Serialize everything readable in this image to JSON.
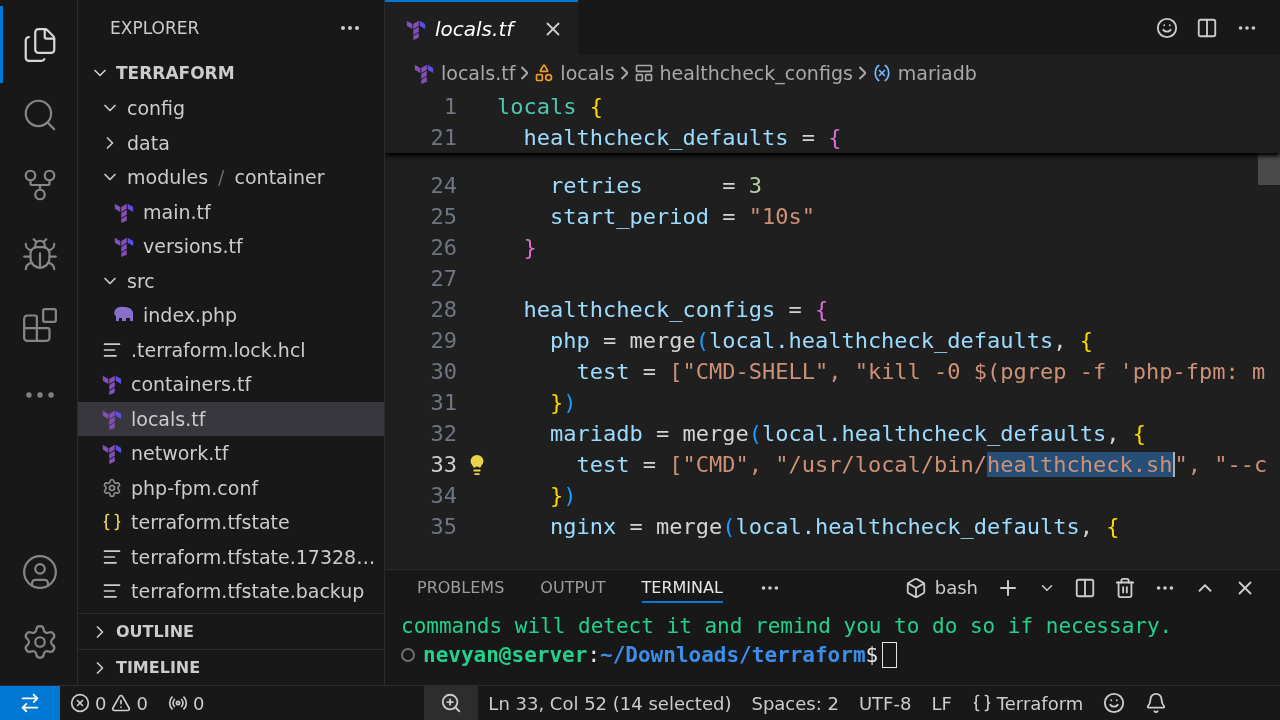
{
  "activity_bar": {
    "top": [
      {
        "kind": "explorer",
        "selected": true
      },
      {
        "kind": "search",
        "selected": false
      },
      {
        "kind": "source_control",
        "selected": false
      },
      {
        "kind": "run_debug",
        "selected": false
      },
      {
        "kind": "extensions",
        "selected": false
      },
      {
        "kind": "more",
        "selected": false
      }
    ],
    "bottom": [
      {
        "kind": "accounts"
      },
      {
        "kind": "manage"
      }
    ]
  },
  "sidebar": {
    "title": "EXPLORER",
    "folder": {
      "label": "TERRAFORM",
      "expanded": true,
      "items": [
        {
          "kind": "folder",
          "label": "config",
          "expanded": true,
          "selected": false
        },
        {
          "kind": "folder",
          "label": "data",
          "expanded": false,
          "selected": false
        },
        {
          "kind": "folder",
          "label": "modules",
          "label_2": "container",
          "separator": "/",
          "expanded": true,
          "selected": false,
          "children": [
            {
              "kind": "terraform",
              "label": "main.tf",
              "selected": false
            },
            {
              "kind": "terraform",
              "label": "versions.tf",
              "selected": false
            }
          ]
        },
        {
          "kind": "folder",
          "label": "src",
          "expanded": true,
          "selected": false,
          "children": [
            {
              "kind": "php",
              "label": "index.php",
              "selected": false
            }
          ]
        },
        {
          "kind": "lines",
          "label": ".terraform.lock.hcl",
          "selected": false
        },
        {
          "kind": "terraform",
          "label": "containers.tf",
          "selected": false
        },
        {
          "kind": "terraform",
          "label": "locals.tf",
          "selected": true
        },
        {
          "kind": "terraform",
          "label": "network.tf",
          "selected": false
        },
        {
          "kind": "gear",
          "label": "php-fpm.conf",
          "selected": false
        },
        {
          "kind": "braces",
          "label": "terraform.tfstate",
          "selected": false
        },
        {
          "kind": "lines",
          "label": "terraform.tfstate.17328…",
          "selected": false
        },
        {
          "kind": "lines",
          "label": "terraform.tfstate.backup",
          "selected": false
        }
      ]
    },
    "sections": [
      {
        "label": "OUTLINE",
        "expanded": false
      },
      {
        "label": "TIMELINE",
        "expanded": false
      }
    ]
  },
  "editor": {
    "tab": {
      "label": "locals.tf",
      "preview": true,
      "selected": true
    },
    "actions": [
      {
        "kind": "smile"
      },
      {
        "kind": "split"
      },
      {
        "kind": "more"
      }
    ],
    "breadcrumb": [
      {
        "kind": "file",
        "label": "locals.tf"
      },
      {
        "kind": "block",
        "label": "locals"
      },
      {
        "kind": "object",
        "label": "healthcheck_configs"
      },
      {
        "kind": "variable",
        "label": "mariadb"
      }
    ],
    "sticky_lines": [
      {
        "number": "1",
        "tokens": [
          {
            "t": "locals ",
            "kind": "kw"
          },
          {
            "t": "{",
            "kind": "b1"
          }
        ]
      },
      {
        "number": "21",
        "tokens": [
          {
            "t": "  healthcheck_defaults",
            "kind": "id"
          },
          {
            "t": " = ",
            "kind": "plain"
          },
          {
            "t": "{",
            "kind": "b2"
          }
        ]
      }
    ],
    "lines": [
      {
        "number": "24",
        "current": false,
        "lightbulb": false,
        "tokens": [
          {
            "t": "    retries",
            "kind": "id"
          },
          {
            "t": "      = ",
            "kind": "plain"
          },
          {
            "t": "3",
            "kind": "num"
          }
        ]
      },
      {
        "number": "25",
        "current": false,
        "lightbulb": false,
        "tokens": [
          {
            "t": "    start_period",
            "kind": "id"
          },
          {
            "t": " = ",
            "kind": "plain"
          },
          {
            "t": "\"10s\"",
            "kind": "str"
          }
        ]
      },
      {
        "number": "26",
        "current": false,
        "lightbulb": false,
        "tokens": [
          {
            "t": "  }",
            "kind": "b2"
          }
        ]
      },
      {
        "number": "27",
        "current": false,
        "lightbulb": false
      },
      {
        "number": "28",
        "current": false,
        "lightbulb": false,
        "tokens": [
          {
            "t": "  healthcheck_configs",
            "kind": "id"
          },
          {
            "t": " = ",
            "kind": "plain"
          },
          {
            "t": "{",
            "kind": "b2"
          }
        ]
      },
      {
        "number": "29",
        "current": false,
        "lightbulb": false,
        "tokens": [
          {
            "t": "    php",
            "kind": "id"
          },
          {
            "t": " = merge",
            "kind": "plain"
          },
          {
            "t": "(",
            "kind": "b3"
          },
          {
            "t": "local.healthcheck_defaults",
            "kind": "id"
          },
          {
            "t": ", ",
            "kind": "plain"
          },
          {
            "t": "{",
            "kind": "b1"
          }
        ]
      },
      {
        "number": "30",
        "current": false,
        "lightbulb": false,
        "tokens": [
          {
            "t": "      test",
            "kind": "id"
          },
          {
            "t": " = ",
            "kind": "plain"
          },
          {
            "t": "[\"CMD-SHELL\", \"kill -0 $(pgrep -f 'php-fpm: m",
            "kind": "str"
          }
        ]
      },
      {
        "number": "31",
        "current": false,
        "lightbulb": false,
        "tokens": [
          {
            "t": "    }",
            "kind": "b1"
          },
          {
            "t": ")",
            "kind": "b3"
          }
        ]
      },
      {
        "number": "32",
        "current": false,
        "lightbulb": false,
        "tokens": [
          {
            "t": "    mariadb",
            "kind": "id"
          },
          {
            "t": " = merge",
            "kind": "plain"
          },
          {
            "t": "(",
            "kind": "b3"
          },
          {
            "t": "local.healthcheck_defaults",
            "kind": "id"
          },
          {
            "t": ", ",
            "kind": "plain"
          },
          {
            "t": "{",
            "kind": "b1"
          }
        ]
      },
      {
        "number": "33",
        "current": true,
        "lightbulb": true,
        "tokens": [
          {
            "t": "      test",
            "kind": "id"
          },
          {
            "t": " = ",
            "kind": "plain"
          },
          {
            "t": "[\"CMD\", \"/usr/local/bin/",
            "kind": "str"
          },
          {
            "t": "healthcheck.sh",
            "kind": "selected"
          },
          {
            "t": "\", \"--c",
            "kind": "str"
          }
        ]
      },
      {
        "number": "34",
        "current": false,
        "lightbulb": false,
        "tokens": [
          {
            "t": "    }",
            "kind": "b1"
          },
          {
            "t": ")",
            "kind": "b3"
          }
        ]
      },
      {
        "number": "35",
        "current": false,
        "lightbulb": false,
        "tokens": [
          {
            "t": "    nginx",
            "kind": "id"
          },
          {
            "t": " = merge",
            "kind": "plain"
          },
          {
            "t": "(",
            "kind": "b3"
          },
          {
            "t": "local.healthcheck_defaults",
            "kind": "id"
          },
          {
            "t": ", ",
            "kind": "plain"
          },
          {
            "t": "{",
            "kind": "b1"
          }
        ]
      }
    ]
  },
  "panel": {
    "tabs": [
      {
        "label": "PROBLEMS",
        "selected": false
      },
      {
        "label": "OUTPUT",
        "selected": false
      },
      {
        "label": "TERMINAL",
        "selected": true
      }
    ],
    "shell": "bash",
    "terminal": {
      "output": "commands will detect it and remind you to do so if necessary.",
      "user": "nevyan@server",
      "separator": ":",
      "path": "~/Downloads/terraform",
      "symbol": "$"
    }
  },
  "status_bar": {
    "errors": "0",
    "warnings": "0",
    "ports": "0",
    "position": "Ln 33, Col 52 (14 selected)",
    "indentation": "Spaces: 2",
    "encoding": "UTF-8",
    "eol": "LF",
    "language": "Terraform"
  }
}
